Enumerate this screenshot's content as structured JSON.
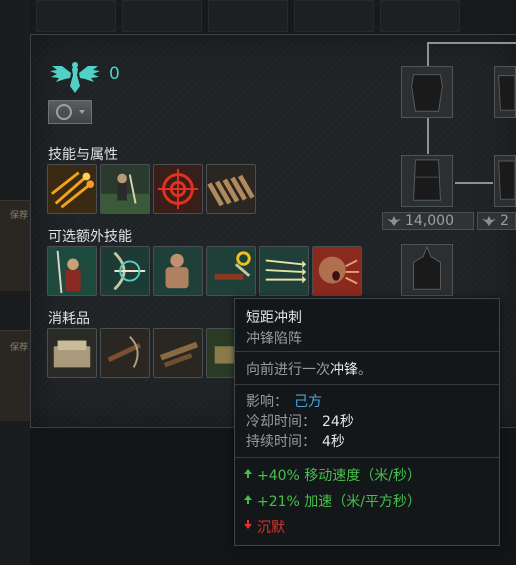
{
  "faction": {
    "count": "0"
  },
  "sections": {
    "skills_title": "技能与属性",
    "optional_title": "可选额外技能",
    "consumables_title": "消耗品"
  },
  "skill_icons": [
    "flaming-arrows-icon",
    "soldier-in-field-icon",
    "crosshair-target-icon",
    "arrow-quiver-icon"
  ],
  "optional_icons": [
    "spear-warrior-icon",
    "bow-shot-icon",
    "muscular-warrior-icon",
    "crossbow-reload-icon",
    "arrow-volley-icon",
    "shouting-soldier-icon"
  ],
  "consumable_icons": [
    "supply-pack-icon",
    "crossbow-icon",
    "crossbow-bolts-icon",
    "ammunition-icon"
  ],
  "left_tags": [
    "保荐",
    "保荐"
  ],
  "units": {
    "costs": [
      "14,000",
      "2"
    ]
  },
  "tooltip": {
    "title": "短距冲刺",
    "subtitle": "冲锋陷阵",
    "desc_prefix": "向前进行一次",
    "desc_highlight": "冲锋",
    "desc_suffix": "。",
    "affects_label": "影响：",
    "affects_value": "己方",
    "cooldown_label": "冷却时间：",
    "cooldown_value": "24秒",
    "duration_label": "持续时间：",
    "duration_value": "4秒",
    "effects": [
      {
        "text": "+40% 移动速度（米/秒）",
        "kind": "positive"
      },
      {
        "text": "+21% 加速（米/平方秒）",
        "kind": "positive"
      },
      {
        "text": "沉默",
        "kind": "negative"
      }
    ]
  },
  "colors": {
    "accent_teal": "#4fd1c5",
    "positive": "#45c04a",
    "negative": "#d8342a",
    "link_blue": "#48a8e0"
  }
}
